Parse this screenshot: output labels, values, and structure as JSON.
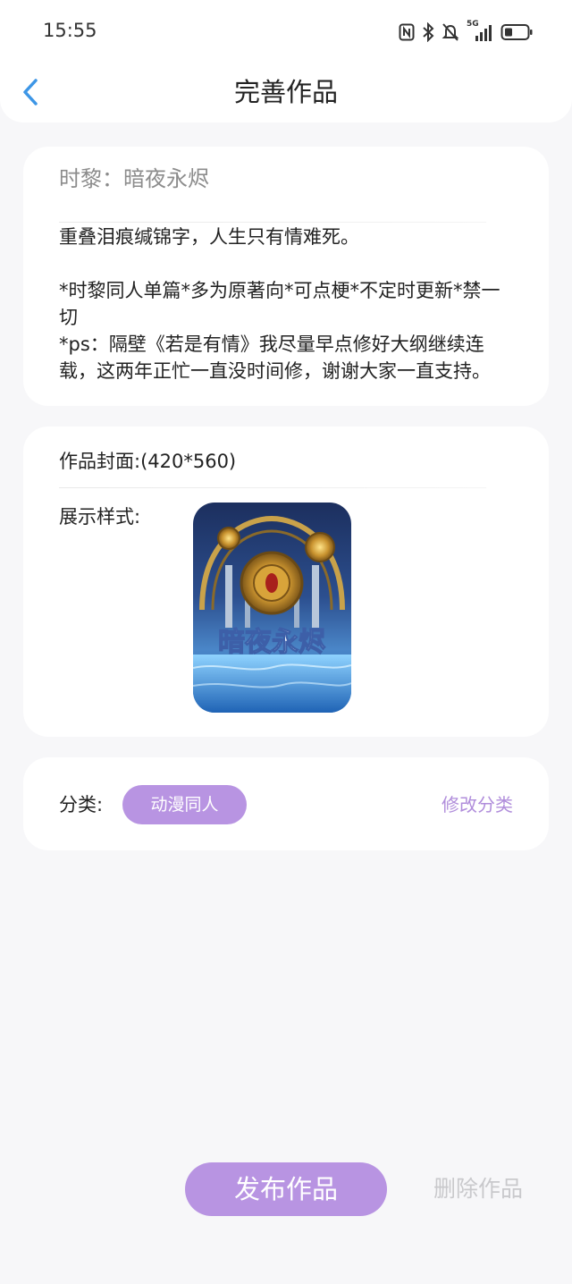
{
  "status_bar": {
    "time": "15:55",
    "network": "5G",
    "icons": [
      "nfc-icon",
      "bluetooth-icon",
      "mute-bell-icon",
      "signal-icon",
      "battery-icon"
    ]
  },
  "header": {
    "title": "完善作品",
    "back_icon": "chevron-left-icon"
  },
  "work": {
    "title": "时黎：暗夜永烬",
    "intro": "重叠泪痕缄锦字，人生只有情难死。\n\n*时黎同人单篇*多为原著向*可点梗*不定时更新*禁一切\n*ps：隔壁《若是有情》我尽量早点修好大纲继续连载，这两年正忙一直没时间修，谢谢大家一直支持。"
  },
  "cover": {
    "label": "作品封面:(420*560)",
    "style_label": "展示样式:",
    "image_text": "暗夜永烬"
  },
  "category": {
    "label": "分类:",
    "value": "动漫同人",
    "edit_label": "修改分类"
  },
  "actions": {
    "publish_label": "发布作品",
    "delete_label": "删除作品"
  },
  "colors": {
    "accent": "#b894e2",
    "accent_text": "#b08ddb",
    "back_icon": "#3d96e6",
    "disabled_text": "#c9c9cc",
    "background": "#f7f7f9"
  }
}
